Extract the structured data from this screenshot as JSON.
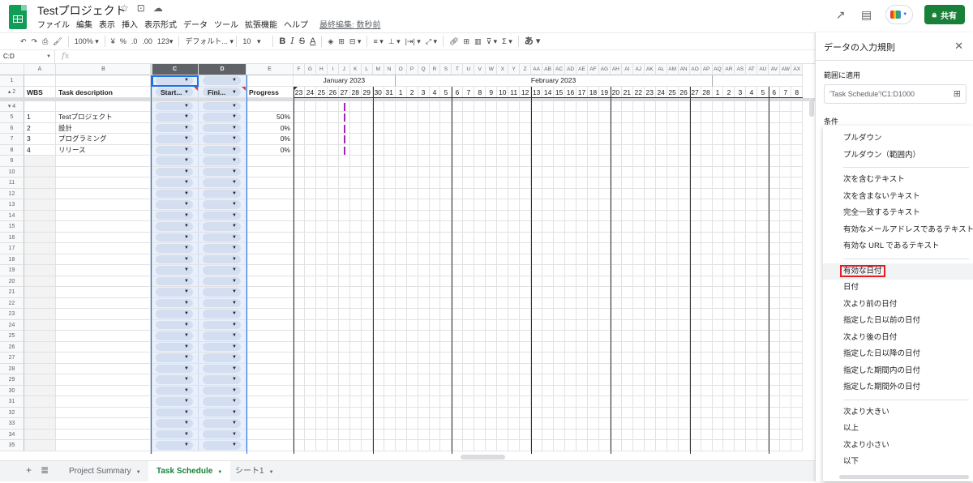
{
  "app": {
    "doc_title": "Testプロジェクト",
    "menu": [
      "ファイル",
      "編集",
      "表示",
      "挿入",
      "表示形式",
      "データ",
      "ツール",
      "拡張機能",
      "ヘルプ"
    ],
    "last_edit": "最終編集: 数秒前",
    "share_label": "共有",
    "icons": [
      "star-icon",
      "move-folder-icon",
      "cloud-status-icon",
      "activity-trend-icon",
      "comment-icon",
      "meet-icon",
      "lock-icon"
    ]
  },
  "toolbar": {
    "zoom": "100%",
    "currency": "¥",
    "percent": "%",
    "dec_decrease": ".0",
    "dec_increase": ".00",
    "more_formats": "123",
    "font": "デフォルト...",
    "font_size": "10",
    "bold": "B",
    "italic": "I",
    "strike": "S",
    "text_color": "A",
    "input_tools": "あ"
  },
  "formula_bar": {
    "name_box": "C:D",
    "fx": "fx",
    "value": ""
  },
  "grid": {
    "columns": [
      "A",
      "B",
      "C",
      "D",
      "E",
      "F",
      "G",
      "H",
      "I",
      "J",
      "K",
      "L",
      "M",
      "N",
      "O",
      "P",
      "Q",
      "R",
      "S",
      "T",
      "U",
      "V",
      "W",
      "X",
      "Y",
      "Z",
      "AA",
      "AB",
      "AC",
      "AD",
      "AE",
      "AF",
      "AG",
      "AH",
      "AI",
      "AJ",
      "AK",
      "AL",
      "AM",
      "AN",
      "AO",
      "AP",
      "AQ",
      "AR",
      "AS",
      "AT",
      "AU",
      "AV",
      "AW",
      "AX"
    ],
    "selected_columns": [
      "C",
      "D"
    ],
    "header_row": {
      "wbs": "WBS",
      "task": "Task description",
      "start": "Start...",
      "finish": "Fini...",
      "progress": "Progress"
    },
    "months": [
      {
        "label": "January 2023"
      },
      {
        "label": "February 2023"
      }
    ],
    "days": [
      "23",
      "24",
      "25",
      "26",
      "27",
      "28",
      "29",
      "30",
      "31",
      "1",
      "2",
      "3",
      "4",
      "5",
      "6",
      "7",
      "8",
      "9",
      "10",
      "11",
      "12",
      "13",
      "14",
      "15",
      "16",
      "17",
      "18",
      "19",
      "20",
      "21",
      "22",
      "23",
      "24",
      "25",
      "26",
      "27",
      "28",
      "1",
      "2",
      "3",
      "4",
      "5",
      "6",
      "7",
      "8"
    ],
    "rows": [
      {
        "num": "5",
        "wbs": "1",
        "task": "Testプロジェクト",
        "progress": "50%"
      },
      {
        "num": "6",
        "wbs": "2",
        "task": "設計",
        "progress": "0%"
      },
      {
        "num": "7",
        "wbs": "3",
        "task": "プログラミング",
        "progress": "0%"
      },
      {
        "num": "8",
        "wbs": "4",
        "task": "リリース",
        "progress": "0%"
      }
    ],
    "row_numbers_top": [
      "1",
      "2",
      "4"
    ],
    "row_numbers_rest": [
      "9",
      "10",
      "11",
      "12",
      "13",
      "14",
      "15",
      "16",
      "17",
      "18",
      "19",
      "20",
      "21",
      "22",
      "23",
      "24",
      "25",
      "26",
      "27",
      "28",
      "29",
      "30",
      "31",
      "32",
      "33",
      "34",
      "35"
    ]
  },
  "sheet_tabs": {
    "add_icon": "+",
    "tabs": [
      {
        "label": "Project Summary",
        "active": false
      },
      {
        "label": "Task Schedule",
        "active": true
      },
      {
        "label": "シート1",
        "active": false
      }
    ]
  },
  "panel": {
    "title": "データの入力規則",
    "range_label": "範囲に適用",
    "range_value": "'Task Schedule'!C1:D1000",
    "criteria_label": "条件",
    "options_group1": [
      "プルダウン",
      "プルダウン（範囲内）"
    ],
    "options_group2": [
      "次を含むテキスト",
      "次を含まないテキスト",
      "完全一致するテキスト",
      "有効なメールアドレスであるテキスト",
      "有効な URL であるテキスト"
    ],
    "options_group3": [
      "有効な日付",
      "日付",
      "次より前の日付",
      "指定した日以前の日付",
      "次より後の日付",
      "指定した日以降の日付",
      "指定した期間内の日付",
      "指定した期間外の日付"
    ],
    "options_group4": [
      "次より大きい",
      "以上",
      "次より小さい",
      "以下"
    ],
    "highlighted_option": "有効な日付"
  },
  "colors": {
    "brand_green": "#188038",
    "selection_blue": "#e8f0fe",
    "chip": "#d3def0",
    "highlight_border": "#e51c23",
    "today_marker": "#9c27b0"
  }
}
